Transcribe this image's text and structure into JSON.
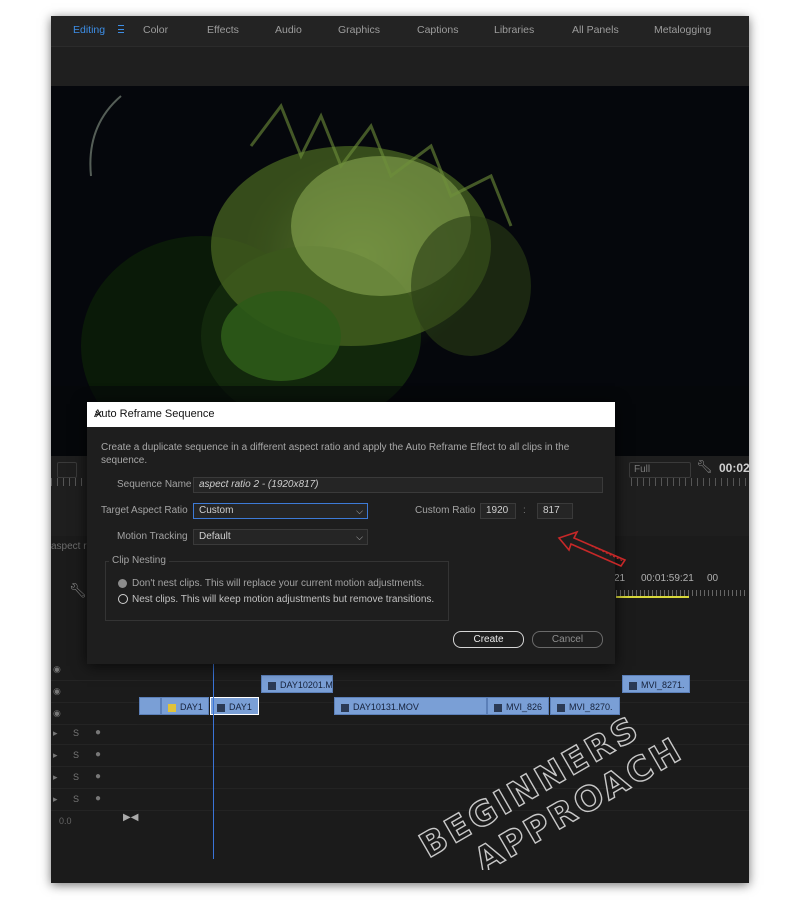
{
  "workspace_tabs": [
    {
      "label": "Editing",
      "active": true
    },
    {
      "label": "Color",
      "active": false
    },
    {
      "label": "Effects",
      "active": false
    },
    {
      "label": "Audio",
      "active": false
    },
    {
      "label": "Graphics",
      "active": false
    },
    {
      "label": "Captions",
      "active": false
    },
    {
      "label": "Libraries",
      "active": false
    },
    {
      "label": "All Panels",
      "active": false
    },
    {
      "label": "Metalogging",
      "active": false
    }
  ],
  "program_monitor": {
    "zoom_label": "Full",
    "timecode": "00:02",
    "wrench_icon": "wrench-icon"
  },
  "timeline": {
    "sequence_label": "aspect r",
    "timecodes": [
      "21",
      "00:01:59:21",
      "00"
    ],
    "clips_v2": [
      {
        "label": "DAY10201.M"
      },
      {
        "label": "MVI_8271."
      }
    ],
    "clips_v1": [
      {
        "label": "DAY1",
        "fx": "yellow"
      },
      {
        "label": "DAY1",
        "selected": true
      },
      {
        "label": "DAY10131.MOV"
      },
      {
        "label": "MVI_826"
      },
      {
        "label": "MVI_8270."
      }
    ],
    "audio_toggle": "S",
    "bottom_value": "0.0"
  },
  "dialog": {
    "title": "Auto Reframe Sequence",
    "description": "Create a duplicate sequence in a different aspect ratio and apply the Auto Reframe Effect to all clips in the sequence.",
    "sequence_name_label": "Sequence Name",
    "sequence_name_value": "aspect ratio 2 - (1920x817)",
    "target_aspect_label": "Target Aspect Ratio",
    "target_aspect_value": "Custom",
    "custom_ratio_label": "Custom Ratio",
    "custom_ratio_w": "1920",
    "custom_ratio_sep": ":",
    "custom_ratio_h": "817",
    "motion_tracking_label": "Motion Tracking",
    "motion_tracking_value": "Default",
    "clip_nesting_title": "Clip Nesting",
    "option_no_nest": "Don't nest clips. This will replace your current motion adjustments.",
    "option_nest": "Nest clips. This will keep motion adjustments but remove transitions.",
    "selected_option": "nest",
    "create_label": "Create",
    "cancel_label": "Cancel"
  },
  "annotation_color": "#c62828",
  "watermark": {
    "line1": "BEGINNERS",
    "line2": "APPROACH"
  }
}
